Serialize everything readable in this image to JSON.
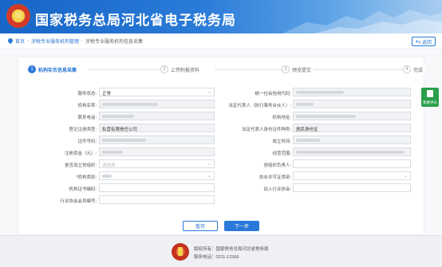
{
  "header": {
    "title": "国家税务总局河北省电子税务局"
  },
  "breadcrumb": {
    "home": "首页",
    "level1": "涉税专业服务机构管理",
    "level2": "涉税专业服务机构信息采集",
    "back_label": "返回"
  },
  "steps": [
    {
      "num": "1",
      "label": "机构实名信息采集",
      "active": true
    },
    {
      "num": "2",
      "label": "上传附报资料",
      "active": false
    },
    {
      "num": "3",
      "label": "预览提交",
      "active": false
    },
    {
      "num": "4",
      "label": "完成",
      "active": false
    }
  ],
  "form": {
    "service_status": {
      "label": "服务状态:",
      "value": "正常"
    },
    "credit_code": {
      "label": "统一社会信用代码:"
    },
    "org_name": {
      "label": "机构名称:"
    },
    "legal_rep": {
      "label": "法定代表人（执行事务合伙人）:"
    },
    "phone": {
      "label": "联系电话:"
    },
    "address": {
      "label": "机构地址:"
    },
    "reg_type": {
      "label": "登记注册类型:",
      "value": "私营有限责任公司"
    },
    "id_type": {
      "label": "法定代表人身份证件种类:",
      "value": "居民身份证"
    },
    "cert_no": {
      "label": "证件号码:"
    },
    "est_date": {
      "label": "成立时间:"
    },
    "capital": {
      "label": "注册资金（元）:"
    },
    "biz_scope": {
      "label": "经营范围:"
    },
    "has_party": {
      "label": "是否设立党组织:",
      "placeholder": "请选择"
    },
    "party_leader": {
      "label": "党组织负责人:"
    },
    "org_category": {
      "label": "*机构类别:",
      "value": ""
    },
    "license_type": {
      "label": "执业许可证类别:"
    },
    "org_cert_no": {
      "label": "机构证书编码:"
    },
    "join_assoc": {
      "label": "加入行业协会:"
    },
    "assoc_member_no": {
      "label": "行业协会会员编号:"
    }
  },
  "buttons": {
    "save": "暂存",
    "next": "下一步"
  },
  "float_widget": {
    "label": "我要评价"
  },
  "footer": {
    "line1": "版权所有：国家税务总局河北省税务局",
    "line2": "服务电话：0311-12366"
  },
  "colors": {
    "primary": "#2a78d8",
    "header": "#1766c7",
    "float": "#2aa04a"
  }
}
